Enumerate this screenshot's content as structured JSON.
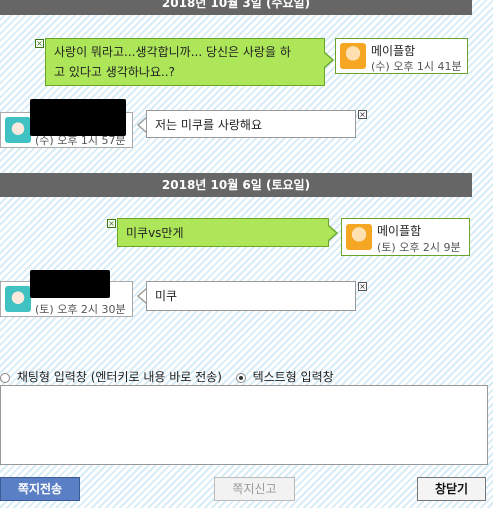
{
  "conversation": {
    "groups": [
      {
        "date": "2018년 10월 3일 (수요일)",
        "messages": [
          {
            "direction": "sent",
            "text_line1": "사랑이 뭐라고...생각합니까... 당신은 사랑을 하",
            "text_line2": "고 있다고 생각하나요..?",
            "sender": "메이플함",
            "time": "(수) 오후 1시 41분"
          },
          {
            "direction": "received",
            "text": "저는 미쿠를 사랑해요",
            "time": "(수) 오후 1시 57분"
          }
        ]
      },
      {
        "date": "2018년 10월 6일 (토요일)",
        "messages": [
          {
            "direction": "sent",
            "text": "미쿠vs만게",
            "sender": "메이플함",
            "time": "(토) 오후 2시 9분"
          },
          {
            "direction": "received",
            "text": "미쿠",
            "time": "(토) 오후 2시 30분"
          }
        ]
      }
    ]
  },
  "input_mode": {
    "chat_label": "채팅형 입력창 (엔터키로 내용 바로 전송)",
    "text_label": "텍스트형 입력창",
    "selected": "text"
  },
  "buttons": {
    "send": "쪽지전송",
    "report": "쪽지신고",
    "close": "창닫기"
  },
  "close_glyph": "×",
  "colors": {
    "sent_bubble": "#aee65a",
    "received_bubble": "#ffffff",
    "date_bar": "#666666",
    "send_button": "#5a7fc4"
  },
  "icons": {
    "sent_avatar": "maple-avatar",
    "received_avatar": "miku-avatar"
  }
}
